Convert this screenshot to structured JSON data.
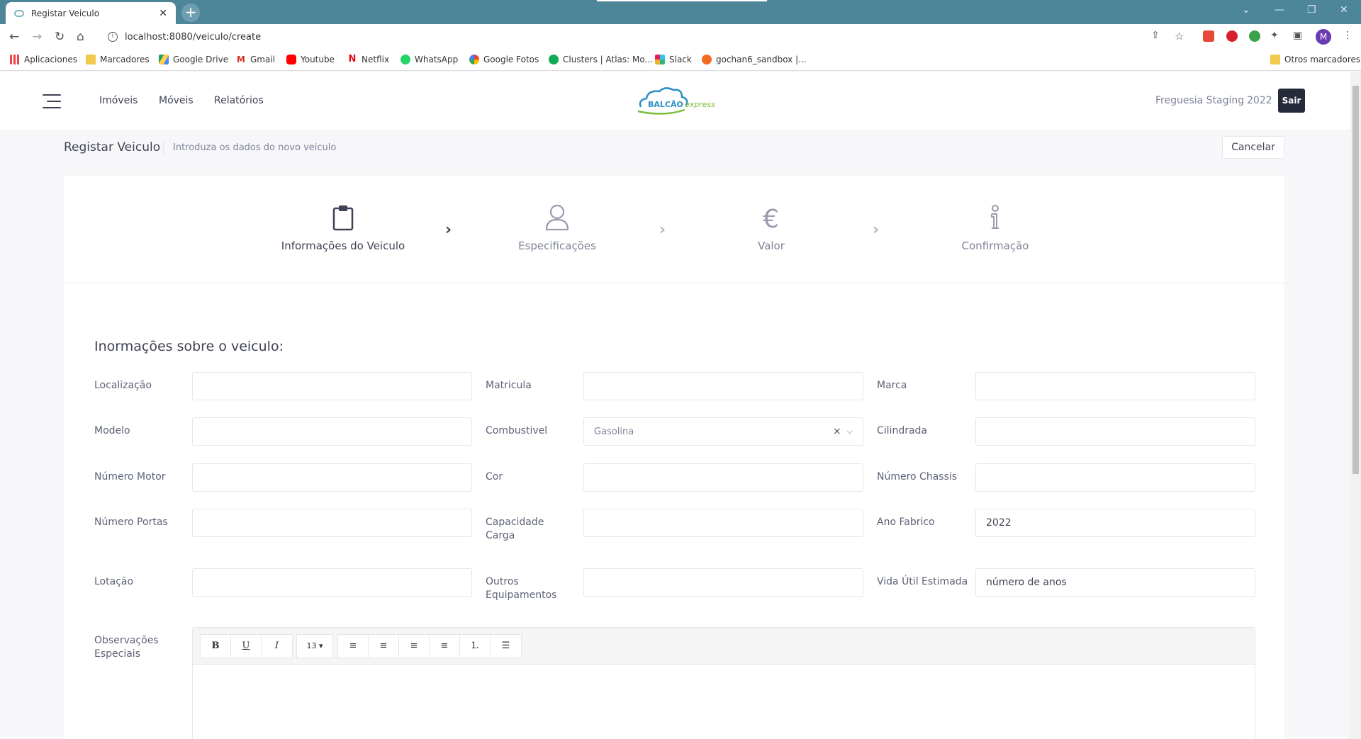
{
  "browser": {
    "tab_title": "Registar Veiculo",
    "tab_close": "✕",
    "new_tab": "+",
    "url": "localhost:8080/veiculo/create",
    "profile_initial": "M",
    "bookmarks": [
      "Aplicaciones",
      "Marcadores",
      "Google Drive",
      "Gmail",
      "Youtube",
      "Netflix",
      "WhatsApp",
      "Google Fotos",
      "Clusters | Atlas: Mo...",
      "Slack",
      "gochan6_sandbox |...",
      "Otros marcadores"
    ]
  },
  "header": {
    "menu": [
      "Imóveis",
      "Móveis",
      "Relatórios"
    ],
    "logo_text": "BALCÃO",
    "logo_sub": "express",
    "organization": "Freguesia Staging",
    "year": "2022",
    "logout_label": "Sair"
  },
  "subheader": {
    "title": "Registar Veiculo",
    "description": "Introduza os dados do novo veiculo",
    "cancel_label": "Cancelar"
  },
  "wizard": {
    "steps": [
      {
        "label": "Informações do Veiculo",
        "icon": "clipboard-icon",
        "active": true
      },
      {
        "label": "Especificações",
        "icon": "user-icon",
        "active": false
      },
      {
        "label": "Valor",
        "icon": "euro-icon",
        "active": false
      },
      {
        "label": "Confirmação",
        "icon": "info-icon",
        "active": false
      }
    ]
  },
  "form": {
    "title": "Inormações sobre o veiculo:",
    "fields": {
      "localizacao": {
        "label": "Localização",
        "value": ""
      },
      "matricula": {
        "label": "Matricula",
        "value": ""
      },
      "marca": {
        "label": "Marca",
        "value": ""
      },
      "modelo": {
        "label": "Modelo",
        "value": ""
      },
      "combustivel": {
        "label": "Combustivel",
        "value": "Gasolina"
      },
      "cilindrada": {
        "label": "Cilindrada",
        "value": ""
      },
      "numero_motor": {
        "label": "Número Motor",
        "value": ""
      },
      "cor": {
        "label": "Cor",
        "value": ""
      },
      "numero_chassis": {
        "label": "Número Chassis",
        "value": ""
      },
      "numero_portas": {
        "label": "Número Portas",
        "value": ""
      },
      "capacidade_carga": {
        "label": "Capacidade Carga",
        "value": ""
      },
      "ano_fabrico": {
        "label": "Ano Fabrico",
        "value": "2022"
      },
      "lotacao": {
        "label": "Lotação",
        "value": ""
      },
      "outros_equipamentos": {
        "label": "Outros Equipamentos",
        "value": ""
      },
      "vida_util": {
        "label": "Vida Útil Estimada",
        "value": "",
        "placeholder": "número de anos"
      },
      "observacoes": {
        "label": "Observações Especiais",
        "value": ""
      }
    },
    "editor": {
      "bold": "B",
      "underline": "U",
      "italic": "I",
      "font_size": "13 ▾",
      "align_left": "≡",
      "align_center": "≡",
      "align_right": "≡",
      "justify": "≡",
      "ordered_list": "⒈",
      "unordered_list": "☰"
    }
  }
}
